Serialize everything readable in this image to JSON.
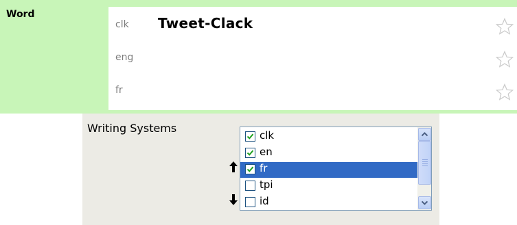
{
  "word_field": {
    "label": "Word",
    "rows": [
      {
        "code": "clk",
        "value": "Tweet-Clack",
        "starred": false
      },
      {
        "code": "eng",
        "value": "",
        "starred": false
      },
      {
        "code": "fr",
        "value": "",
        "starred": false
      }
    ]
  },
  "writing_systems": {
    "label": "Writing Systems",
    "items": [
      {
        "label": "clk",
        "checked": true,
        "selected": false
      },
      {
        "label": "en",
        "checked": true,
        "selected": false
      },
      {
        "label": "fr",
        "checked": true,
        "selected": true
      },
      {
        "label": "tpi",
        "checked": false,
        "selected": false
      },
      {
        "label": "id",
        "checked": false,
        "selected": false
      }
    ],
    "move_up_icon": "up-arrow-icon",
    "move_down_icon": "down-arrow-icon"
  },
  "colors": {
    "panel_green": "#c8f5b8",
    "selection_blue": "#316ac5",
    "control_bg": "#ecebe5",
    "check_green": "#21a121"
  }
}
